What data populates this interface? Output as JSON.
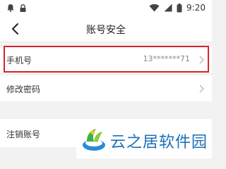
{
  "status_bar": {
    "time": "9:20",
    "icons": [
      "notification-icon",
      "lock-icon",
      "wifi-icon",
      "signal-icon",
      "battery-icon"
    ]
  },
  "header": {
    "title": "账号安全",
    "back_icon": "back-arrow-icon"
  },
  "settings": {
    "rows": [
      {
        "label": "手机号",
        "value": "13*******71",
        "highlighted": true
      },
      {
        "label": "修改密码",
        "value": ""
      },
      {
        "label": "注销账号",
        "value": ""
      }
    ]
  },
  "watermark": {
    "text": "云之居软件园"
  },
  "colors": {
    "highlight": "#d9232b",
    "watermark_text": "#1d6fb8",
    "background": "#f2f2f2"
  }
}
